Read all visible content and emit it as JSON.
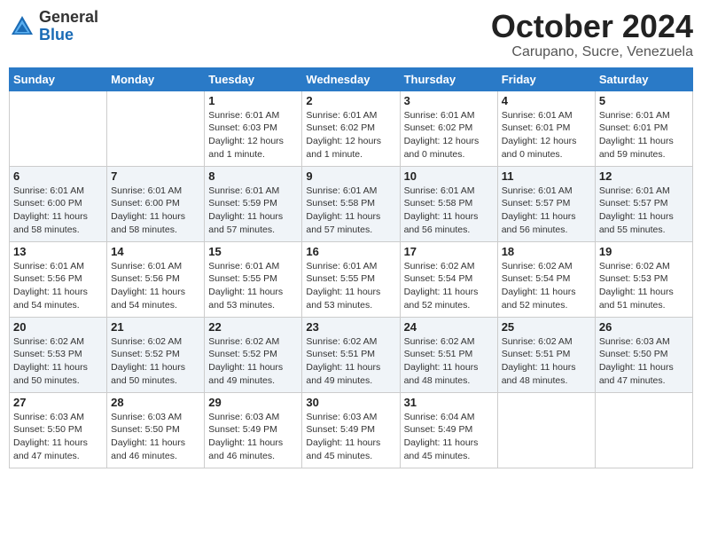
{
  "header": {
    "logo_line1": "General",
    "logo_line2": "Blue",
    "month_title": "October 2024",
    "subtitle": "Carupano, Sucre, Venezuela"
  },
  "weekdays": [
    "Sunday",
    "Monday",
    "Tuesday",
    "Wednesday",
    "Thursday",
    "Friday",
    "Saturday"
  ],
  "weeks": [
    [
      {
        "day": "",
        "info": ""
      },
      {
        "day": "",
        "info": ""
      },
      {
        "day": "1",
        "info": "Sunrise: 6:01 AM\nSunset: 6:03 PM\nDaylight: 12 hours\nand 1 minute."
      },
      {
        "day": "2",
        "info": "Sunrise: 6:01 AM\nSunset: 6:02 PM\nDaylight: 12 hours\nand 1 minute."
      },
      {
        "day": "3",
        "info": "Sunrise: 6:01 AM\nSunset: 6:02 PM\nDaylight: 12 hours\nand 0 minutes."
      },
      {
        "day": "4",
        "info": "Sunrise: 6:01 AM\nSunset: 6:01 PM\nDaylight: 12 hours\nand 0 minutes."
      },
      {
        "day": "5",
        "info": "Sunrise: 6:01 AM\nSunset: 6:01 PM\nDaylight: 11 hours\nand 59 minutes."
      }
    ],
    [
      {
        "day": "6",
        "info": "Sunrise: 6:01 AM\nSunset: 6:00 PM\nDaylight: 11 hours\nand 58 minutes."
      },
      {
        "day": "7",
        "info": "Sunrise: 6:01 AM\nSunset: 6:00 PM\nDaylight: 11 hours\nand 58 minutes."
      },
      {
        "day": "8",
        "info": "Sunrise: 6:01 AM\nSunset: 5:59 PM\nDaylight: 11 hours\nand 57 minutes."
      },
      {
        "day": "9",
        "info": "Sunrise: 6:01 AM\nSunset: 5:58 PM\nDaylight: 11 hours\nand 57 minutes."
      },
      {
        "day": "10",
        "info": "Sunrise: 6:01 AM\nSunset: 5:58 PM\nDaylight: 11 hours\nand 56 minutes."
      },
      {
        "day": "11",
        "info": "Sunrise: 6:01 AM\nSunset: 5:57 PM\nDaylight: 11 hours\nand 56 minutes."
      },
      {
        "day": "12",
        "info": "Sunrise: 6:01 AM\nSunset: 5:57 PM\nDaylight: 11 hours\nand 55 minutes."
      }
    ],
    [
      {
        "day": "13",
        "info": "Sunrise: 6:01 AM\nSunset: 5:56 PM\nDaylight: 11 hours\nand 54 minutes."
      },
      {
        "day": "14",
        "info": "Sunrise: 6:01 AM\nSunset: 5:56 PM\nDaylight: 11 hours\nand 54 minutes."
      },
      {
        "day": "15",
        "info": "Sunrise: 6:01 AM\nSunset: 5:55 PM\nDaylight: 11 hours\nand 53 minutes."
      },
      {
        "day": "16",
        "info": "Sunrise: 6:01 AM\nSunset: 5:55 PM\nDaylight: 11 hours\nand 53 minutes."
      },
      {
        "day": "17",
        "info": "Sunrise: 6:02 AM\nSunset: 5:54 PM\nDaylight: 11 hours\nand 52 minutes."
      },
      {
        "day": "18",
        "info": "Sunrise: 6:02 AM\nSunset: 5:54 PM\nDaylight: 11 hours\nand 52 minutes."
      },
      {
        "day": "19",
        "info": "Sunrise: 6:02 AM\nSunset: 5:53 PM\nDaylight: 11 hours\nand 51 minutes."
      }
    ],
    [
      {
        "day": "20",
        "info": "Sunrise: 6:02 AM\nSunset: 5:53 PM\nDaylight: 11 hours\nand 50 minutes."
      },
      {
        "day": "21",
        "info": "Sunrise: 6:02 AM\nSunset: 5:52 PM\nDaylight: 11 hours\nand 50 minutes."
      },
      {
        "day": "22",
        "info": "Sunrise: 6:02 AM\nSunset: 5:52 PM\nDaylight: 11 hours\nand 49 minutes."
      },
      {
        "day": "23",
        "info": "Sunrise: 6:02 AM\nSunset: 5:51 PM\nDaylight: 11 hours\nand 49 minutes."
      },
      {
        "day": "24",
        "info": "Sunrise: 6:02 AM\nSunset: 5:51 PM\nDaylight: 11 hours\nand 48 minutes."
      },
      {
        "day": "25",
        "info": "Sunrise: 6:02 AM\nSunset: 5:51 PM\nDaylight: 11 hours\nand 48 minutes."
      },
      {
        "day": "26",
        "info": "Sunrise: 6:03 AM\nSunset: 5:50 PM\nDaylight: 11 hours\nand 47 minutes."
      }
    ],
    [
      {
        "day": "27",
        "info": "Sunrise: 6:03 AM\nSunset: 5:50 PM\nDaylight: 11 hours\nand 47 minutes."
      },
      {
        "day": "28",
        "info": "Sunrise: 6:03 AM\nSunset: 5:50 PM\nDaylight: 11 hours\nand 46 minutes."
      },
      {
        "day": "29",
        "info": "Sunrise: 6:03 AM\nSunset: 5:49 PM\nDaylight: 11 hours\nand 46 minutes."
      },
      {
        "day": "30",
        "info": "Sunrise: 6:03 AM\nSunset: 5:49 PM\nDaylight: 11 hours\nand 45 minutes."
      },
      {
        "day": "31",
        "info": "Sunrise: 6:04 AM\nSunset: 5:49 PM\nDaylight: 11 hours\nand 45 minutes."
      },
      {
        "day": "",
        "info": ""
      },
      {
        "day": "",
        "info": ""
      }
    ]
  ]
}
